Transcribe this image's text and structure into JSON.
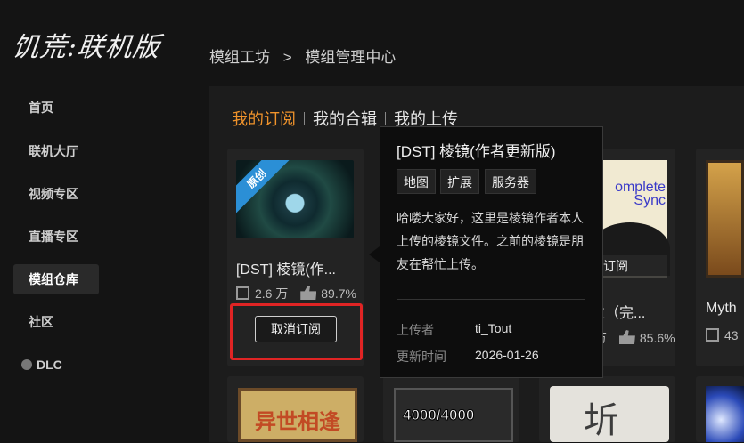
{
  "app": {
    "logo_text": "饥荒:联机版"
  },
  "sidebar": {
    "items": [
      {
        "label": "首页"
      },
      {
        "label": "联机大厅"
      },
      {
        "label": "视频专区"
      },
      {
        "label": "直播专区"
      },
      {
        "label": "模组仓库",
        "active": true
      },
      {
        "label": "社区"
      },
      {
        "label": "DLC"
      }
    ]
  },
  "breadcrumb": {
    "parent": "模组工坊",
    "separator": ">",
    "current": "模组管理中心"
  },
  "tabs": [
    {
      "label": "我的订阅",
      "active": true
    },
    {
      "label": "我的合辑"
    },
    {
      "label": "我的上传"
    }
  ],
  "cards": [
    {
      "title": "[DST] 棱镜(作...",
      "badge": "原创",
      "subscribers": "2.6 万",
      "rating": "89.7%",
      "button": "取消订阅"
    },
    {
      "title": "位（完...",
      "overlay": "订阅",
      "thumb_text": "omplete Sync",
      "rating": "85.6%",
      "subscribers_partial": "万"
    },
    {
      "title": "Myth",
      "subscribers_partial": "43"
    },
    {
      "thumb_text": "异世相逢"
    },
    {
      "thumb_text": "4000/4000"
    },
    {
      "thumb_text": "圻"
    }
  ],
  "popup": {
    "title": "[DST] 棱镜(作者更新版)",
    "tags": [
      "地图",
      "扩展",
      "服务器"
    ],
    "description": "哈喽大家好，这里是棱镜作者本人上传的棱镜文件。之前的棱镜是朋友在帮忙上传。",
    "uploader_label": "上传者",
    "uploader": "ti_Tout",
    "updated_label": "更新时间",
    "updated": "2026-01-26"
  },
  "colors": {
    "accent": "#f0932b",
    "highlight": "#e02424",
    "badge": "#2b8fd6"
  }
}
